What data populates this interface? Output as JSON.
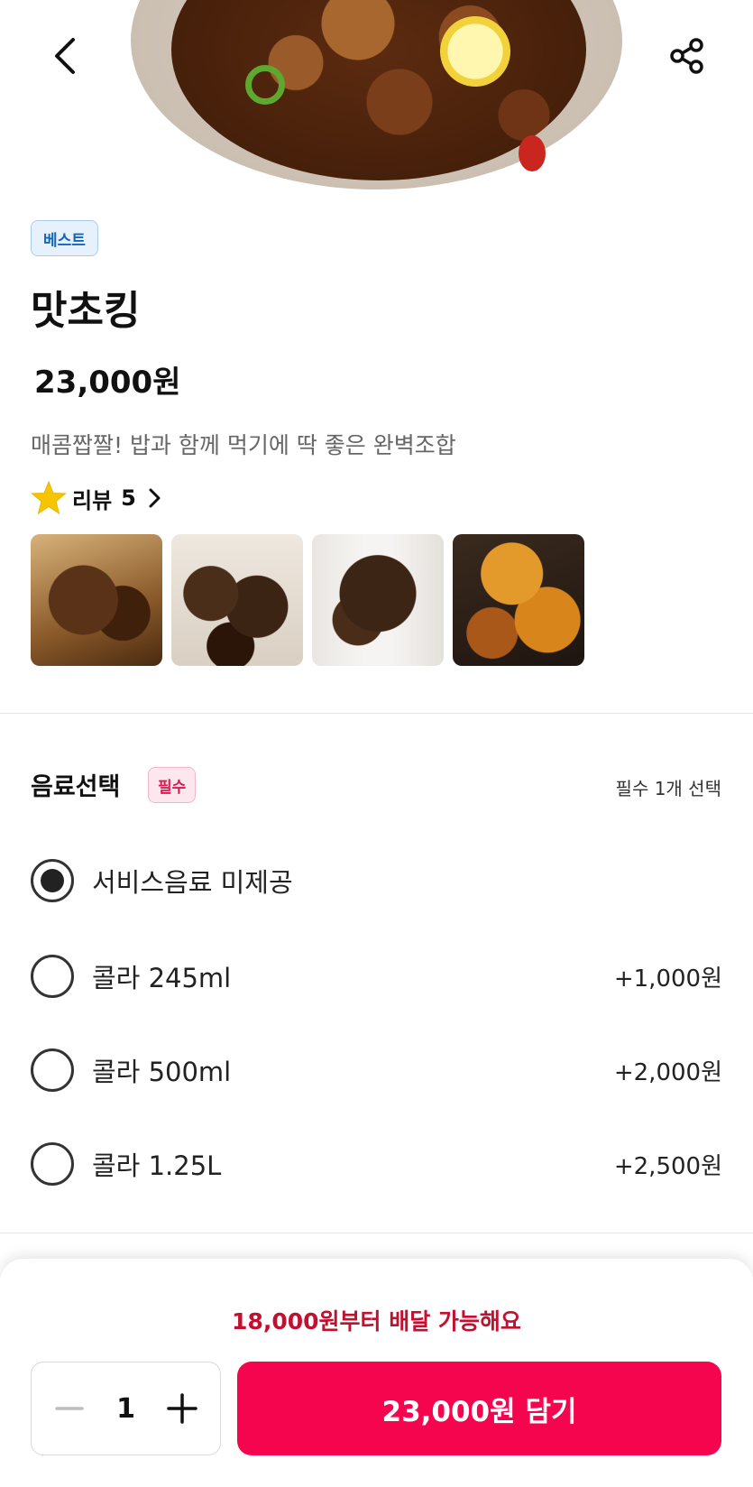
{
  "header": {
    "back_icon": "chevron-left-icon",
    "share_icon": "share-icon"
  },
  "product": {
    "badge": "베스트",
    "name": "맛초킹",
    "price": "23,000원",
    "description": "매콤짭짤! 밥과 함께 먹기에 딱 좋은 완벽조합",
    "review_label": "리뷰",
    "review_count": "5",
    "review_photo_count": 4
  },
  "options": {
    "title": "음료선택",
    "required_badge": "필수",
    "rule": "필수 1개 선택",
    "items": [
      {
        "name": "서비스음료 미제공",
        "extra": "",
        "selected": true
      },
      {
        "name": "콜라 245ml",
        "extra": "+1,000원",
        "selected": false
      },
      {
        "name": "콜라 500ml",
        "extra": "+2,000원",
        "selected": false
      },
      {
        "name": "콜라 1.25L",
        "extra": "+2,500원",
        "selected": false
      }
    ]
  },
  "footer": {
    "min_order": "18,000원부터 배달 가능해요",
    "quantity": "1",
    "cart_button": "23,000원 담기"
  },
  "colors": {
    "accent": "#f5054d",
    "min_order_text": "#c21030",
    "best_badge_bg": "#e6f1fc",
    "best_badge_text": "#1565b8",
    "required_badge_bg": "#fde7ee",
    "required_badge_text": "#e0174f",
    "star": "#f7c500"
  }
}
